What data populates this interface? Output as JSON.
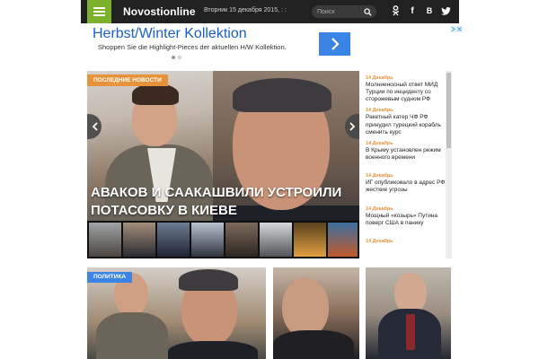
{
  "header": {
    "menu_icon": "hamburger-menu-icon",
    "logo": "Novostionline",
    "dateline": "Вторник 15 декабря 2015, : :",
    "search_placeholder": "Поиск",
    "social": [
      {
        "name": "odnoklassniki",
        "glyph": "ok"
      },
      {
        "name": "facebook",
        "glyph": "f"
      },
      {
        "name": "vkontakte",
        "glyph": "B"
      },
      {
        "name": "twitter",
        "glyph": "t"
      }
    ],
    "bar_color": "#212121",
    "accent_color": "#7cb12b"
  },
  "ad": {
    "title": "Herbst/Winter Kollektion",
    "subtitle": "Shoppen Sie die Highlight-Pieces der aktuellen H/W Kollektion.",
    "button_icon": "chevron-right-icon",
    "title_color": "#1a5fc4",
    "button_color": "#3a84e6"
  },
  "hero": {
    "badge": "ПОСЛЕДНИЕ НОВОСТИ",
    "badge_color": "#e6933b",
    "title": "АВАКОВ И СААКАШВИЛИ УСТРОИЛИ ПОТАСОВКУ В КИЕВЕ"
  },
  "news": [
    {
      "date": "14 Декабрь",
      "text": "Молниеносный ответ МИД Турции по инциденту со сторожевым судном РФ"
    },
    {
      "date": "14 Декабрь",
      "text": "Ракетный катер ЧФ РФ принудил турецкий корабль сменить курс"
    },
    {
      "date": "14 Декабрь",
      "text": "В Крыму установлен режим военного времени"
    },
    {
      "date": "14 Декабрь",
      "text": "ИГ опубликовало в адрес РФ жесткие угрозы"
    },
    {
      "date": "14 Декабрь",
      "text": "Мощный «козырь» Путина поверг США в панику"
    },
    {
      "date": "14 Декабрь",
      "text": ""
    }
  ],
  "section": {
    "badge": "ПОЛИТИКА",
    "badge_color": "#3a84e6"
  }
}
